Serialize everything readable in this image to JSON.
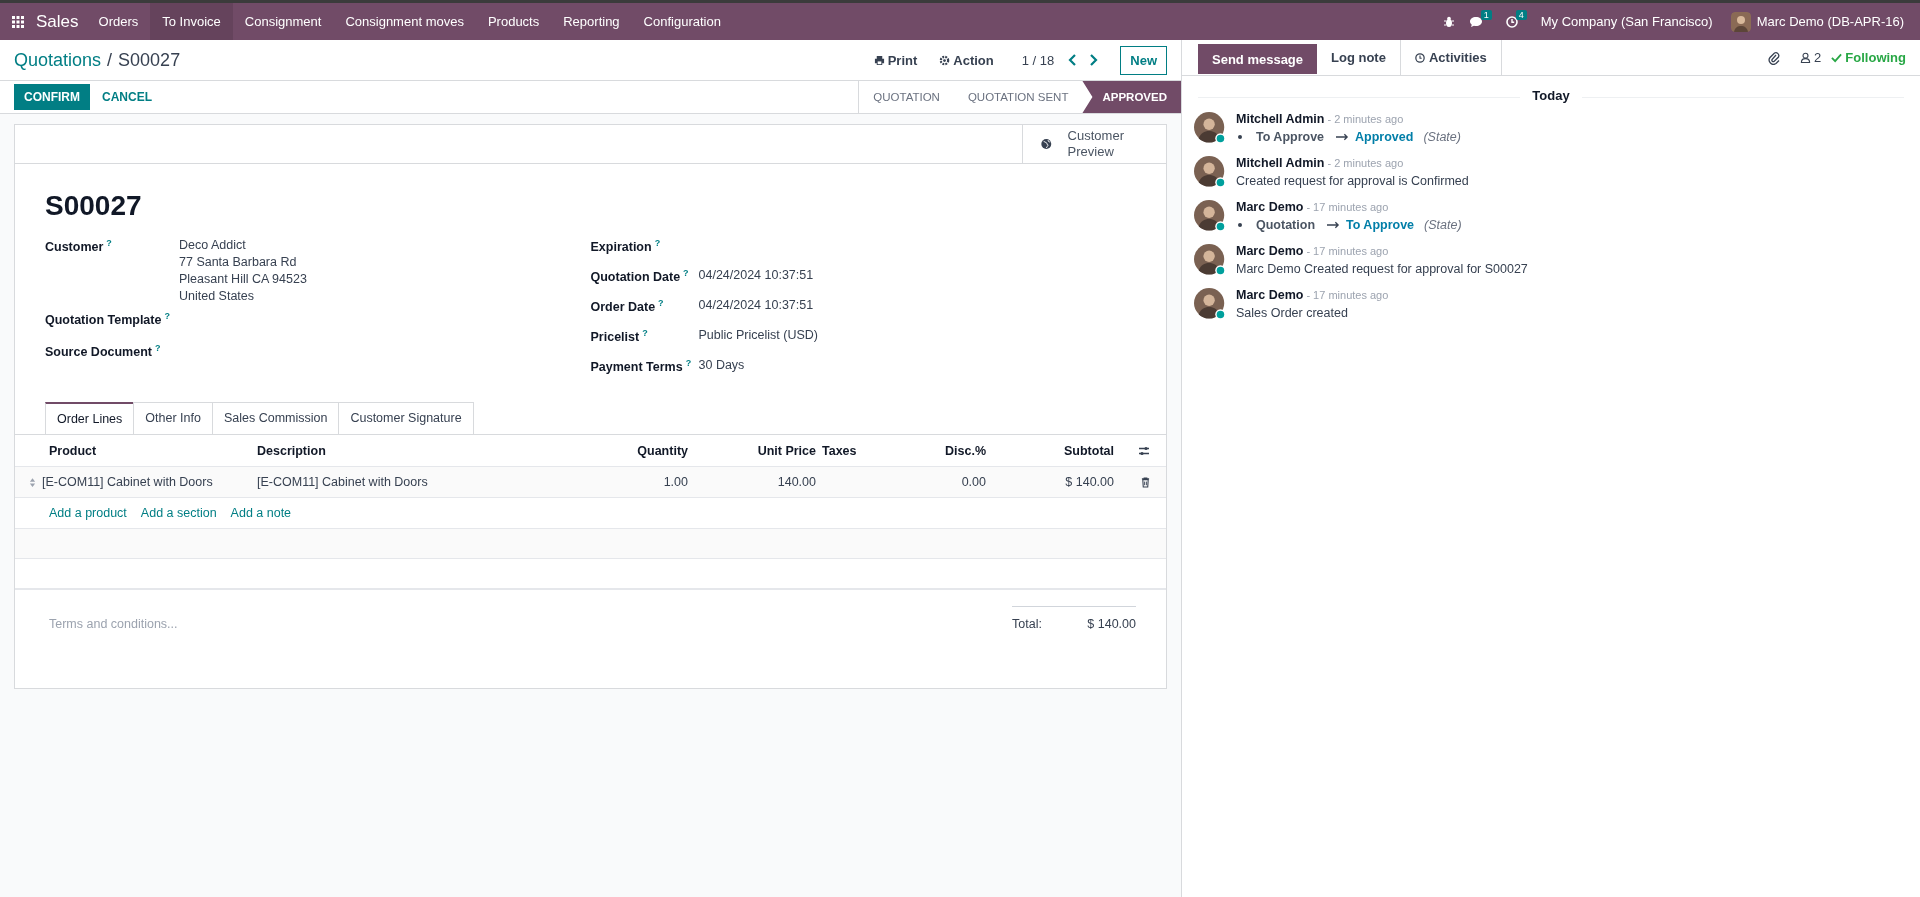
{
  "navbar": {
    "app": "Sales",
    "menu": [
      {
        "label": "Orders",
        "selected": false
      },
      {
        "label": "To Invoice",
        "selected": true
      },
      {
        "label": "Consignment",
        "selected": false
      },
      {
        "label": "Consignment moves",
        "selected": false
      },
      {
        "label": "Products",
        "selected": false
      },
      {
        "label": "Reporting",
        "selected": false
      },
      {
        "label": "Configuration",
        "selected": false
      }
    ],
    "messages_badge": "1",
    "activities_badge": "4",
    "company": "My Company (San Francisco)",
    "user": "Marc Demo (DB-APR-16)"
  },
  "breadcrumb": {
    "parent": "Quotations",
    "separator": "/",
    "current": "S00027"
  },
  "control": {
    "print": "Print",
    "action": "Action",
    "pager": "1 / 18",
    "new": "New"
  },
  "buttons": [
    {
      "label": "CONFIRM",
      "kind": "primary"
    },
    {
      "label": "CANCEL",
      "kind": "link"
    }
  ],
  "stages": [
    {
      "label": "QUOTATION",
      "selected": false
    },
    {
      "label": "QUOTATION SENT",
      "selected": false
    },
    {
      "label": "APPROVED",
      "selected": true
    }
  ],
  "smart_button": "Customer Preview",
  "form": {
    "name": "S00027",
    "left": [
      {
        "label": "Customer",
        "help": "?",
        "value": [
          "Deco Addict",
          "77 Santa Barbara Rd",
          "Pleasant Hill CA 94523",
          "United States"
        ]
      },
      {
        "label": "Quotation Template",
        "help": "?"
      },
      {
        "label": "Source Document",
        "help": "?"
      }
    ],
    "right": [
      {
        "label": "Expiration",
        "help": "?"
      },
      {
        "label": "Quotation Date",
        "help": "?",
        "value": [
          "04/24/2024 10:37:51"
        ]
      },
      {
        "label": "Order Date",
        "help": "?",
        "value": [
          "04/24/2024 10:37:51"
        ]
      },
      {
        "label": "Pricelist",
        "help": "?",
        "value": [
          "Public Pricelist (USD)"
        ]
      },
      {
        "label": "Payment Terms",
        "help": "?",
        "value": [
          "30 Days"
        ]
      }
    ]
  },
  "tabs": [
    {
      "label": "Order Lines",
      "selected": true
    },
    {
      "label": "Other Info",
      "selected": false
    },
    {
      "label": "Sales Commission",
      "selected": false
    },
    {
      "label": "Customer Signature",
      "selected": false
    }
  ],
  "table": {
    "columns": [
      "Product",
      "Description",
      "Quantity",
      "Unit Price",
      "Taxes",
      "Disc.%",
      "Subtotal"
    ],
    "rows": [
      [
        "[E-COM11] Cabinet with Doors",
        "[E-COM11] Cabinet with Doors",
        "1.00",
        "140.00",
        "",
        "0.00",
        "$ 140.00"
      ]
    ],
    "add_links": [
      "Add a product",
      "Add a section",
      "Add a note"
    ]
  },
  "terms": {
    "placeholder": "Terms and conditions..."
  },
  "total": {
    "label": "Total:",
    "value": "$ 140.00"
  },
  "chatter": {
    "tabs": [
      {
        "label": "Send message",
        "selected": true
      },
      {
        "label": "Log note",
        "selected": false
      },
      {
        "label": "Activities",
        "selected": false
      }
    ],
    "followers": "2",
    "following": "Following",
    "day": "Today",
    "messages": [
      {
        "author": "Mitchell Admin",
        "time": "- 2 minutes ago",
        "kind": "tracking",
        "old": "To Approve",
        "new": "Approved",
        "field": "(State)"
      },
      {
        "author": "Mitchell Admin",
        "time": "- 2 minutes ago",
        "kind": "text",
        "body": "Created request for approval is Confirmed"
      },
      {
        "author": "Marc Demo",
        "time": "- 17 minutes ago",
        "kind": "tracking",
        "old": "Quotation",
        "new": "To Approve",
        "field": "(State)"
      },
      {
        "author": "Marc Demo",
        "time": "- 17 minutes ago",
        "kind": "text",
        "body": "Marc Demo Created request for approval for S00027"
      },
      {
        "author": "Marc Demo",
        "time": "- 17 minutes ago",
        "kind": "text",
        "body": "Sales Order created"
      }
    ]
  }
}
